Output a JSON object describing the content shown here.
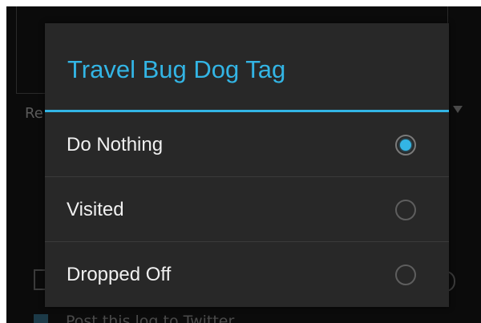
{
  "dialog": {
    "title": "Travel Bug Dog Tag",
    "accent_color": "#33b5e5",
    "options": [
      {
        "label": "Do Nothing",
        "selected": true
      },
      {
        "label": "Visited",
        "selected": false
      },
      {
        "label": "Dropped Off",
        "selected": false
      }
    ]
  },
  "background": {
    "field_label_fragment": "Re",
    "bottom_text_fragment": "Post this log to Twitter"
  }
}
